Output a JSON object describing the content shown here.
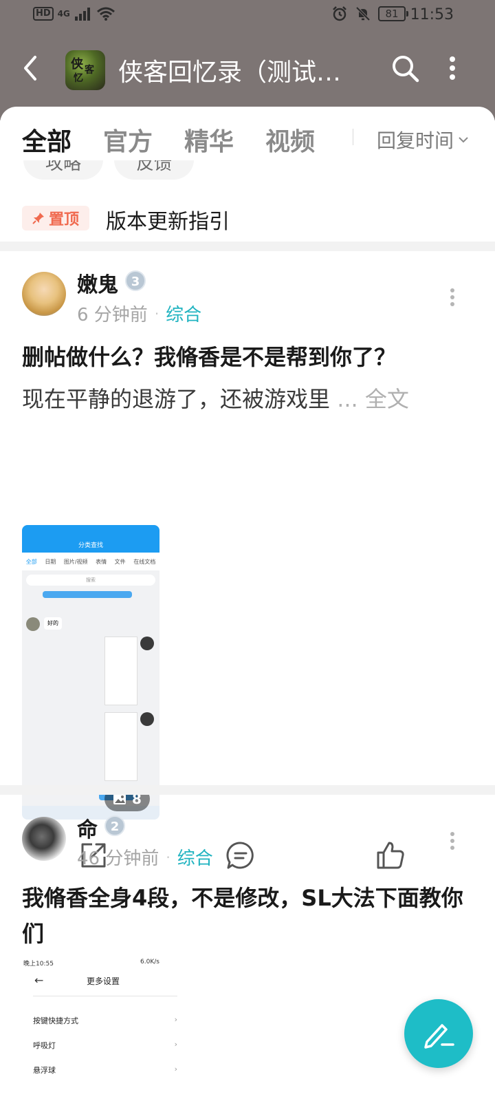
{
  "status_bar": {
    "hd": "HD",
    "network": "4G",
    "battery": "81",
    "time": "11:53"
  },
  "header": {
    "title": "侠客回忆录（测试…"
  },
  "tabs": [
    {
      "label": "全部",
      "active": true
    },
    {
      "label": "官方",
      "active": false
    },
    {
      "label": "精华",
      "active": false
    },
    {
      "label": "视频",
      "active": false
    }
  ],
  "sort": {
    "label": "回复时间"
  },
  "chips": [
    {
      "label": "攻略"
    },
    {
      "label": "反馈"
    }
  ],
  "pinned": {
    "badge": "置顶",
    "title": "版本更新指引"
  },
  "posts": [
    {
      "author": "嫩鬼",
      "level": "3",
      "time": "6 分钟前",
      "category": "综合",
      "title": "删帖做什么？我脩香是不是帮到你了？",
      "excerpt": "现在平静的退游了，还被游戏里",
      "ellipsis": "...",
      "full_text_link": "全文",
      "image_count": "8",
      "thumb": {
        "header_title": "分类查找",
        "tabs": [
          "全部",
          "日期",
          "图片/视频",
          "表情",
          "文件",
          "在线文档"
        ],
        "search": "搜索",
        "chat_text": "好的"
      }
    },
    {
      "author": "命",
      "level": "2",
      "time": "46 分钟前",
      "category": "综合",
      "title": "我脩香全身4段，不是修改，SL大法下面教你们",
      "thumb": {
        "status_left": "晚上10:55",
        "status_right": "6.0K/s",
        "page_title": "更多设置",
        "rows": [
          "按键快捷方式",
          "呼吸灯",
          "悬浮球"
        ]
      }
    }
  ],
  "colors": {
    "header_bg": "#7d7574",
    "accent": "#1fb3c0",
    "pin": "#f06a4f",
    "fab": "#1ebdc7"
  }
}
